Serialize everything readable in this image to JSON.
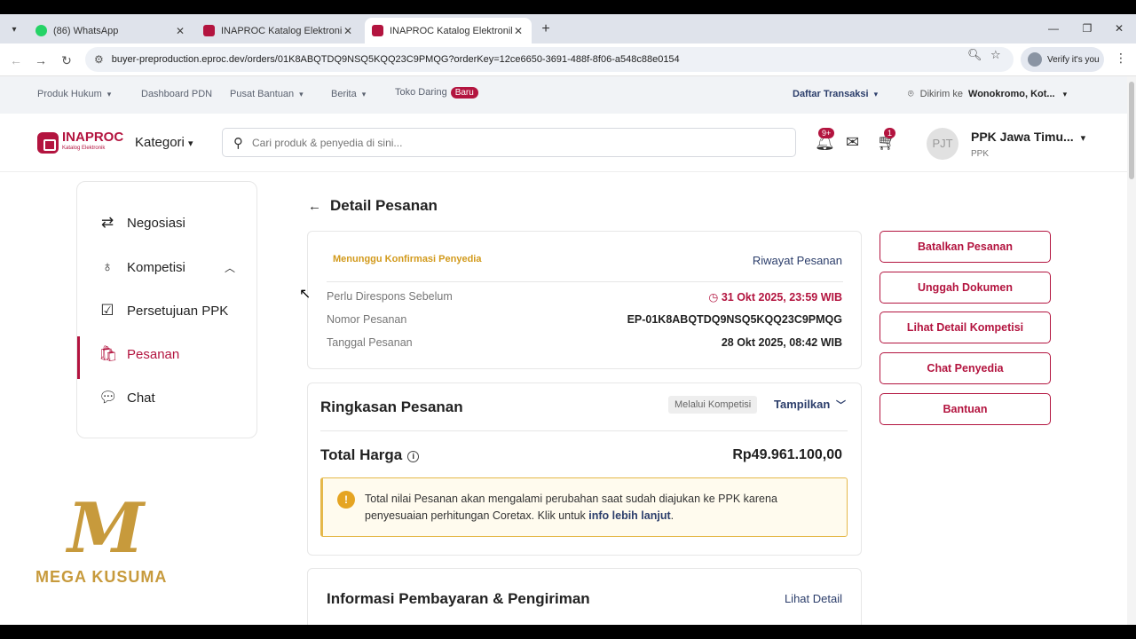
{
  "browser": {
    "tabs": [
      {
        "title": "(86) WhatsApp",
        "favicon_color": "#25D366",
        "active": false
      },
      {
        "title": "INAPROC Katalog Elektronik - P",
        "favicon_color": "#b3143f",
        "active": false
      },
      {
        "title": "INAPROC Katalog Elektronik - P",
        "favicon_color": "#b3143f",
        "active": true
      }
    ],
    "url": "buyer-preproduction.eproc.dev/orders/01K8ABQTDQ9NSQ5KQQ23C9PMQG?orderKey=12ce6650-3691-488f-8f06-a548c88e0154",
    "verify_label": "Verify it's you"
  },
  "topbar": {
    "links": [
      "Produk Hukum",
      "Dashboard PDN",
      "Pusat Bantuan",
      "Berita",
      "Toko Daring"
    ],
    "baru_badge": "Baru",
    "daftar_transaksi": "Daftar Transaksi",
    "dikirim_label": "Dikirim ke",
    "dikirim_value": "Wonokromo, Kot..."
  },
  "header": {
    "logo_text": "INAPROC",
    "logo_sub": "Katalog Elektronik",
    "kategori": "Kategori",
    "search_placeholder": "Cari produk & penyedia di sini...",
    "notif_badge": "9+",
    "cart_badge": "1",
    "avatar_initials": "PJT",
    "user_name": "PPK Jawa Timu...",
    "user_role": "PPK"
  },
  "sidebar": {
    "items": [
      {
        "label": "Negosiasi",
        "icon": "swap-arrows-icon"
      },
      {
        "label": "Kompetisi",
        "icon": "award-icon"
      },
      {
        "label": "Persetujuan PPK",
        "icon": "checkbox-icon"
      },
      {
        "label": "Pesanan",
        "icon": "shopping-bag-icon",
        "active": true
      },
      {
        "label": "Chat",
        "icon": "chat-bubble-icon"
      }
    ]
  },
  "watermark": {
    "text": "MEGA KUSUMA"
  },
  "page": {
    "title": "Detail Pesanan",
    "status": "Menunggu Konfirmasi Penyedia",
    "riwayat": "Riwayat Pesanan",
    "rows": [
      {
        "label": "Perlu Direspons Sebelum",
        "value": "31 Okt 2025, 23:59 WIB"
      },
      {
        "label": "Nomor Pesanan",
        "value": "EP-01K8ABQTDQ9NSQ5KQQ23C9PMQG"
      },
      {
        "label": "Tanggal Pesanan",
        "value": "28 Okt 2025, 08:42 WIB"
      }
    ],
    "ringkasan_title": "Ringkasan Pesanan",
    "melalui_chip": "Melalui Kompetisi",
    "tampilkan": "Tampilkan",
    "total_label": "Total Harga",
    "total_value": "Rp49.961.100,00",
    "alert_text": "Total nilai Pesanan akan mengalami perubahan saat sudah diajukan ke PPK karena penyesuaian perhitungan Coretax. Klik untuk",
    "alert_link": "info lebih lanjut",
    "alert_end": ".",
    "pembayaran_title": "Informasi Pembayaran & Pengiriman",
    "lihat_detail": "Lihat Detail"
  },
  "actions": [
    "Batalkan Pesanan",
    "Unggah Dokumen",
    "Lihat Detail Kompetisi",
    "Chat Penyedia",
    "Bantuan"
  ],
  "colors": {
    "brand": "#b3143f",
    "link": "#2c3e6b",
    "warning": "#d29a1c"
  }
}
